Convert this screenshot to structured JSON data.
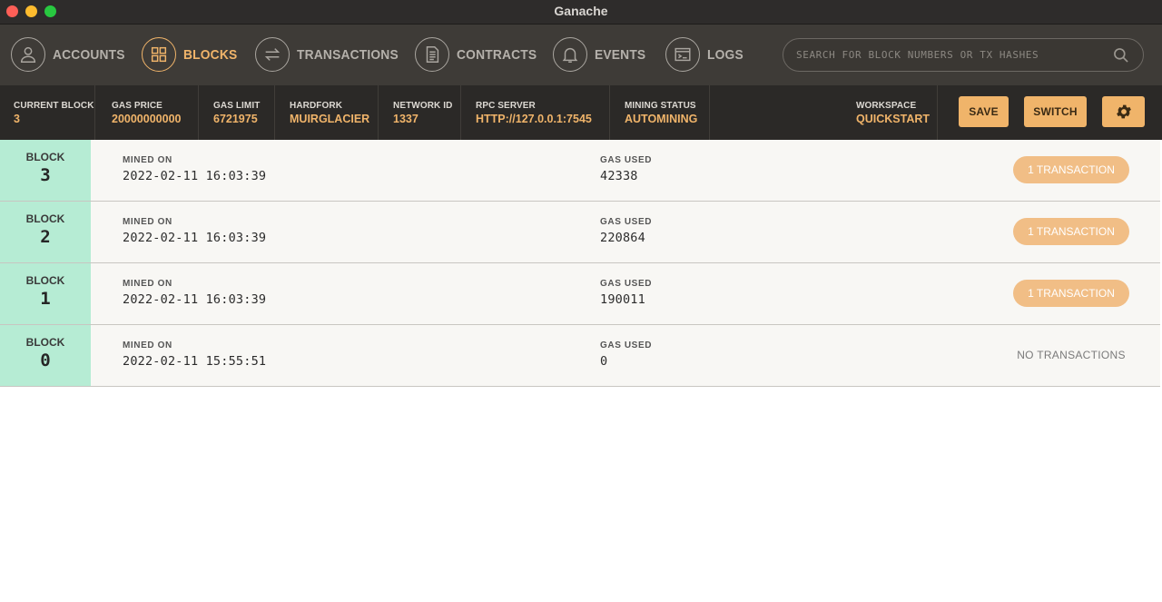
{
  "window": {
    "title": "Ganache"
  },
  "nav": {
    "items": [
      {
        "label": "ACCOUNTS",
        "icon": "user-icon"
      },
      {
        "label": "BLOCKS",
        "icon": "grid-icon",
        "active": true
      },
      {
        "label": "TRANSACTIONS",
        "icon": "transfer-arrows-icon"
      },
      {
        "label": "CONTRACTS",
        "icon": "document-icon"
      },
      {
        "label": "EVENTS",
        "icon": "bell-icon"
      },
      {
        "label": "LOGS",
        "icon": "terminal-icon"
      }
    ],
    "search_placeholder": "SEARCH FOR BLOCK NUMBERS OR TX HASHES"
  },
  "status": {
    "current_block_label": "CURRENT BLOCK",
    "current_block": "3",
    "gas_price_label": "GAS PRICE",
    "gas_price": "20000000000",
    "gas_limit_label": "GAS LIMIT",
    "gas_limit": "6721975",
    "hardfork_label": "HARDFORK",
    "hardfork": "MUIRGLACIER",
    "network_id_label": "NETWORK ID",
    "network_id": "1337",
    "rpc_server_label": "RPC SERVER",
    "rpc_server": "HTTP://127.0.0.1:7545",
    "mining_status_label": "MINING STATUS",
    "mining_status": "AUTOMINING",
    "workspace_label": "WORKSPACE",
    "workspace": "QUICKSTART",
    "save_label": "SAVE",
    "switch_label": "SWITCH"
  },
  "blocks": [
    {
      "block_label": "BLOCK",
      "number": "3",
      "mined_on_label": "MINED ON",
      "mined_on": "2022-02-11 16:03:39",
      "gas_used_label": "GAS USED",
      "gas_used": "42338",
      "tx": "1 TRANSACTION"
    },
    {
      "block_label": "BLOCK",
      "number": "2",
      "mined_on_label": "MINED ON",
      "mined_on": "2022-02-11 16:03:39",
      "gas_used_label": "GAS USED",
      "gas_used": "220864",
      "tx": "1 TRANSACTION"
    },
    {
      "block_label": "BLOCK",
      "number": "1",
      "mined_on_label": "MINED ON",
      "mined_on": "2022-02-11 16:03:39",
      "gas_used_label": "GAS USED",
      "gas_used": "190011",
      "tx": "1 TRANSACTION"
    },
    {
      "block_label": "BLOCK",
      "number": "0",
      "mined_on_label": "MINED ON",
      "mined_on": "2022-02-11 15:55:51",
      "gas_used_label": "GAS USED",
      "gas_used": "0",
      "tx_none": "NO TRANSACTIONS"
    }
  ],
  "colors": {
    "accent": "#f0b46a",
    "nav_bg": "#3e3b37",
    "status_bg": "#2b2927",
    "block_number_bg": "#b6ecd4",
    "tx_badge": "#f1be86"
  }
}
